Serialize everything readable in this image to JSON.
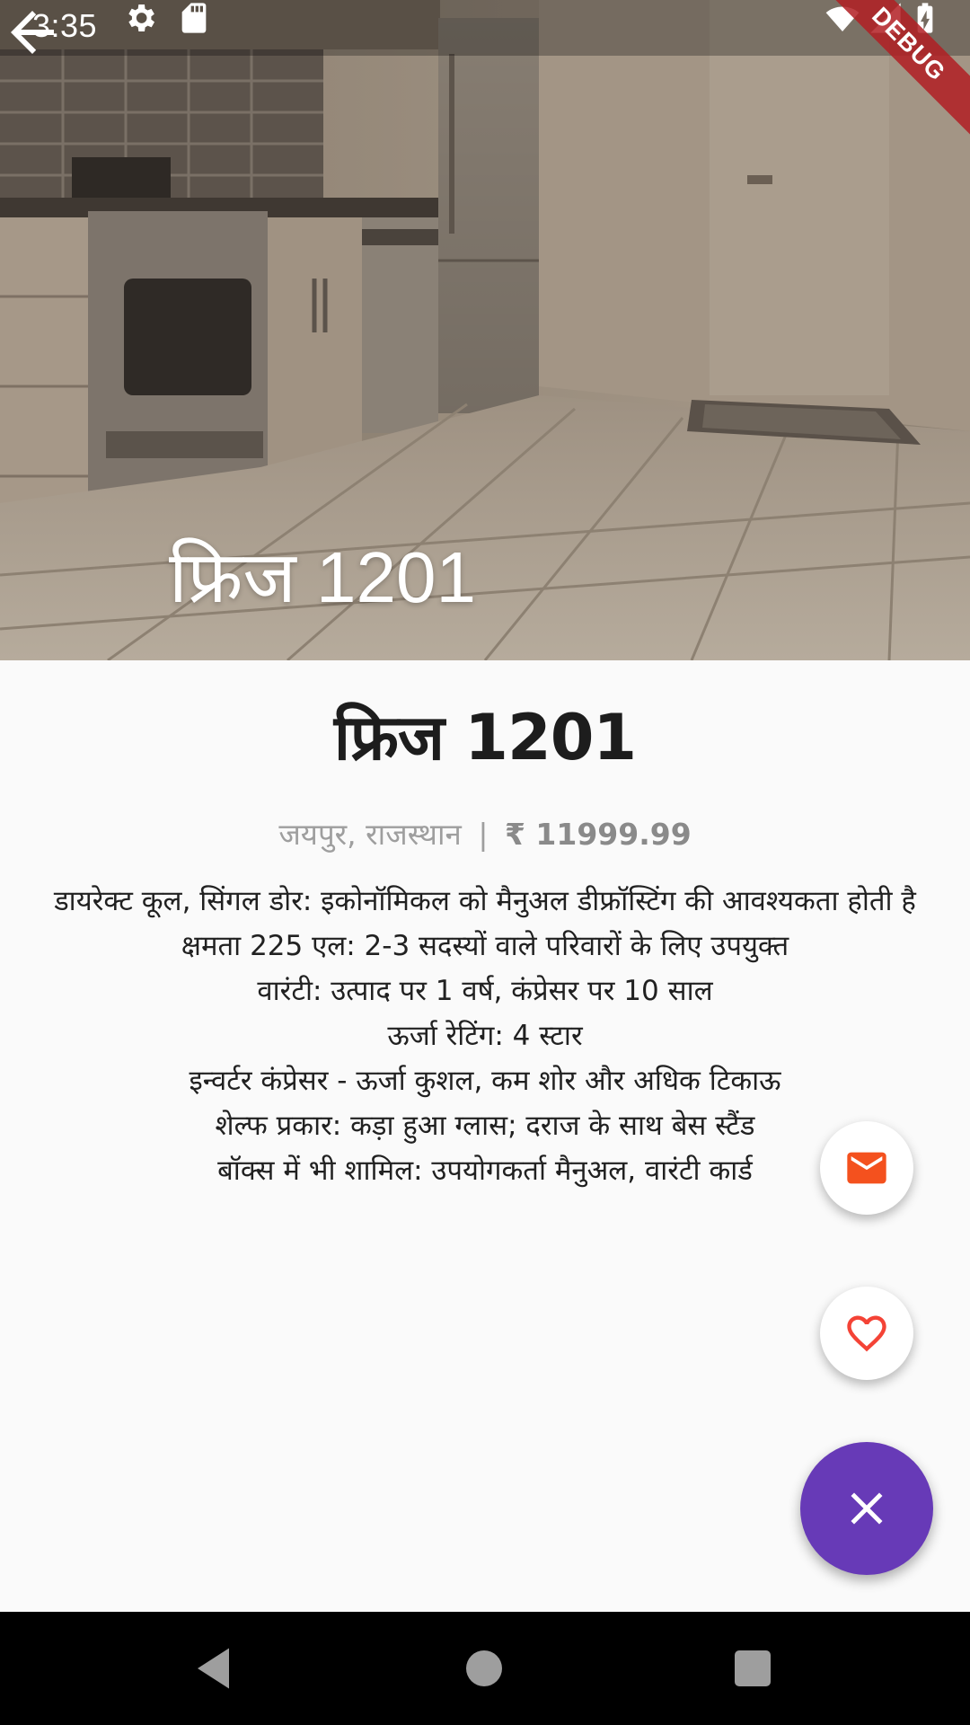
{
  "status_bar": {
    "time": "3:35",
    "icons": [
      "settings-icon",
      "sd-card-icon",
      "wifi-icon",
      "signal-icon",
      "battery-charging-icon"
    ],
    "debug_banner": "DEBUG"
  },
  "app_bar": {
    "back_icon": "arrow-back-icon",
    "title": "फ्रिज 1201"
  },
  "product": {
    "title": "फ्रिज 1201",
    "location": "जयपुर, राजस्थान",
    "separator": "|",
    "price": "₹ 11999.99",
    "description": [
      "डायरेक्ट कूल, सिंगल डोर: इकोनॉमिकल को मैनुअल डीफ्रॉस्टिंग की आवश्यकता होती है",
      "क्षमता 225 एल: 2-3 सदस्यों वाले परिवारों के लिए उपयुक्त",
      "वारंटी: उत्पाद पर 1 वर्ष, कंप्रेसर पर 10 साल",
      "ऊर्जा रेटिंग: 4 स्टार",
      "इन्वर्टर कंप्रेसर - ऊर्जा कुशल, कम शोर और अधिक टिकाऊ",
      "शेल्फ प्रकार: कड़ा हुआ ग्लास; दराज के साथ बेस स्टैंड",
      "बॉक्स में भी शामिल: उपयोगकर्ता मैनुअल, वारंटी कार्ड"
    ]
  },
  "fabs": {
    "mail_icon": "mail-icon",
    "favorite_icon": "heart-outline-icon",
    "close_icon": "close-icon"
  },
  "nav_bar": {
    "icons": [
      "nav-back-icon",
      "nav-home-icon",
      "nav-recents-icon"
    ]
  },
  "colors": {
    "accent_purple": "#673ab7",
    "mail_orange": "#f4511e",
    "heart_red": "#f44336",
    "meta_gray": "#9e9e9e",
    "text_dark": "#212121"
  }
}
